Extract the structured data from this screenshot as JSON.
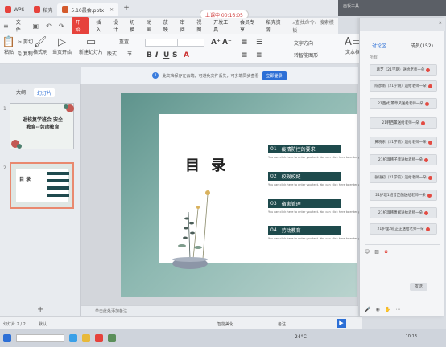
{
  "tabs": [
    {
      "label": "WPS",
      "color": "#e6423c"
    },
    {
      "label": "稻壳",
      "color": "#e6423c"
    },
    {
      "label": "5.10晨会.pptx",
      "color": "#d45a2c"
    }
  ],
  "meeting_label": "上课中 00:16:05",
  "menu": {
    "file": "文件",
    "start": "开始",
    "items": [
      "插入",
      "设计",
      "切换",
      "动画",
      "放映",
      "审阅",
      "视图",
      "开发工具",
      "会员专享",
      "稻壳资源"
    ],
    "search": "查找命令、搜索模板"
  },
  "toolbar": {
    "cut": "剪切",
    "paste": "粘贴",
    "copy": "复制",
    "format_painter": "格式刷",
    "from_current": "当页开始",
    "new_slide": "新建幻灯片",
    "layout": "版式",
    "section": "节",
    "reset": "重置",
    "bold": "B",
    "italic": "I",
    "underline": "U",
    "strike": "S",
    "text_box": "文本框",
    "convert_graphic": "转智能图形",
    "text_direction": "文字方向"
  },
  "notice": {
    "text": "此文档保存在云端，可避免文件丢失，可多端同步查看",
    "button": "立即登录"
  },
  "left_panel": {
    "tab_outline": "大纲",
    "tab_slides": "幻灯片",
    "slide1_num": "1",
    "slide1_title": "返校复学班会 安全教育--劳动教育",
    "slide2_num": "2",
    "slide2_title": "目 录"
  },
  "slide": {
    "title": "目 录",
    "sections": [
      {
        "num": "01",
        "label": "疫情防控的要求"
      },
      {
        "num": "02",
        "label": "校规校纪"
      },
      {
        "num": "03",
        "label": "宿舍管理"
      },
      {
        "num": "04",
        "label": "劳动教育"
      }
    ],
    "subtext": "You can click here to enter you text. You can click here to enter you text"
  },
  "notes_placeholder": "单击此处添加备注",
  "status": {
    "slide_count": "幻灯片 2 / 2",
    "theme": "默认",
    "beautify": "智能美化",
    "notes": "备注"
  },
  "taskbar": {
    "temp": "24°C",
    "time": "10:13"
  },
  "panel": {
    "header": "画板工具",
    "tab_discussion": "讨论区",
    "tab_members": "成员(152)",
    "sub": "所有",
    "messages": [
      "葛芝（21学期）送给老师一朵",
      "陈彦南（21学期）送给老师一朵",
      "21西式 薰草风送给老师一朵",
      "21韩西薰送给老师一朵",
      "黄晓东（21学前）送给老师一朵",
      "21护理韩子菲送给老师一朵",
      "张语初（21学前）送给老师一朵",
      "21护理1班曾芷菡送给老师一朵",
      "21护理韩勇斌送给老师一朵",
      "21护理2班芷芷送给老师一朵"
    ],
    "send": "发送"
  }
}
